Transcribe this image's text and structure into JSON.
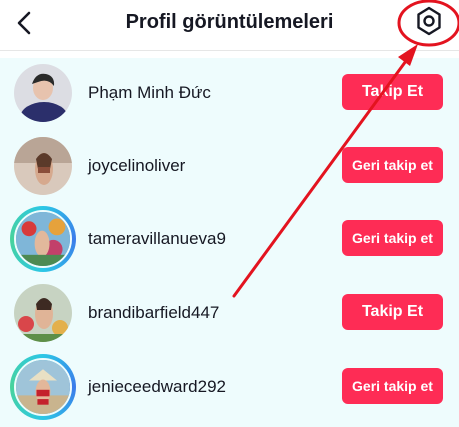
{
  "header": {
    "title": "Profil görüntülemeleri",
    "back_icon": "chevron-left-icon",
    "settings_icon": "gear-icon"
  },
  "viewers": [
    {
      "username": "Phạm Minh Đức",
      "button": "Takip Et"
    },
    {
      "username": "joycelinoliver",
      "button": "Geri takip et"
    },
    {
      "username": "tameravillanueva9",
      "button": "Geri takip et"
    },
    {
      "username": "brandibarfield447",
      "button": "Takip Et"
    },
    {
      "username": "jenieceedward292",
      "button": "Geri takip et"
    }
  ],
  "colors": {
    "accent": "#fe2c55",
    "list_background": "#eefcfd",
    "annotation": "#e3131f"
  }
}
